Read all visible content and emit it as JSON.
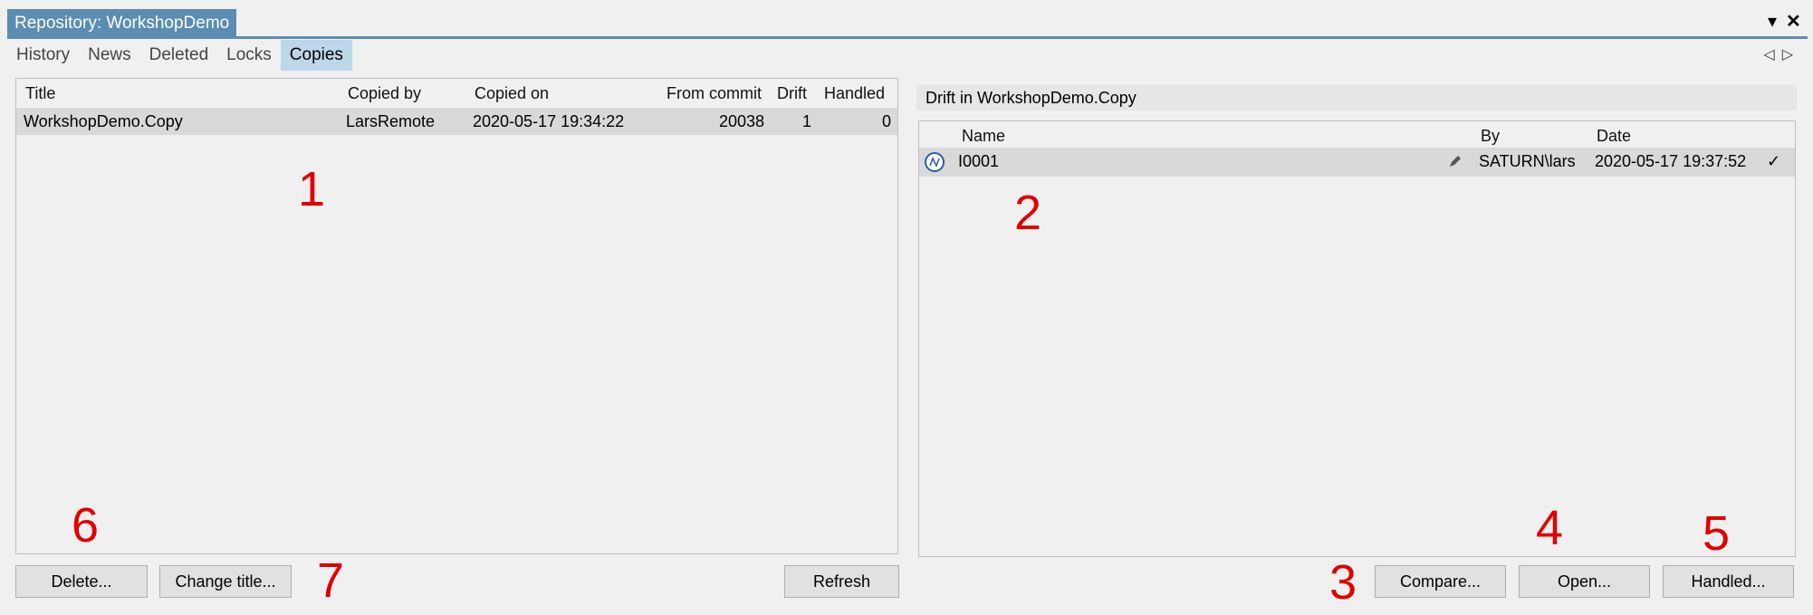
{
  "window": {
    "title": "Repository: WorkshopDemo",
    "menu_glyph": "▾",
    "close_glyph": "✕"
  },
  "tabs": [
    "History",
    "News",
    "Deleted",
    "Locks",
    "Copies"
  ],
  "active_tab": "Copies",
  "tab_scroll": {
    "left": "◁",
    "right": "▷"
  },
  "copies": {
    "columns": [
      "Title",
      "Copied by",
      "Copied on",
      "From commit",
      "Drift",
      "Handled"
    ],
    "rows": [
      {
        "title": "WorkshopDemo.Copy",
        "copied_by": "LarsRemote",
        "copied_on": "2020-05-17 19:34:22",
        "from_commit": "20038",
        "drift": "1",
        "handled": "0"
      }
    ]
  },
  "drift": {
    "label": "Drift in WorkshopDemo.Copy",
    "columns": [
      "Name",
      "By",
      "Date"
    ],
    "rows": [
      {
        "icon": "item-type-icon",
        "name": "I0001",
        "edit_icon": "pencil-icon",
        "by": "SATURN\\lars",
        "date": "2020-05-17 19:37:52",
        "check": "✓"
      }
    ]
  },
  "buttons": {
    "delete": "Delete...",
    "change_title": "Change title...",
    "refresh": "Refresh",
    "compare": "Compare...",
    "open": "Open...",
    "handled": "Handled..."
  },
  "annotations": [
    "1",
    "2",
    "3",
    "4",
    "5",
    "6",
    "7"
  ],
  "colors": {
    "accent": "#5b8db3",
    "active_tab": "#bcd6ea",
    "selection": "#d9d9d9",
    "annotation": "#e00000"
  }
}
